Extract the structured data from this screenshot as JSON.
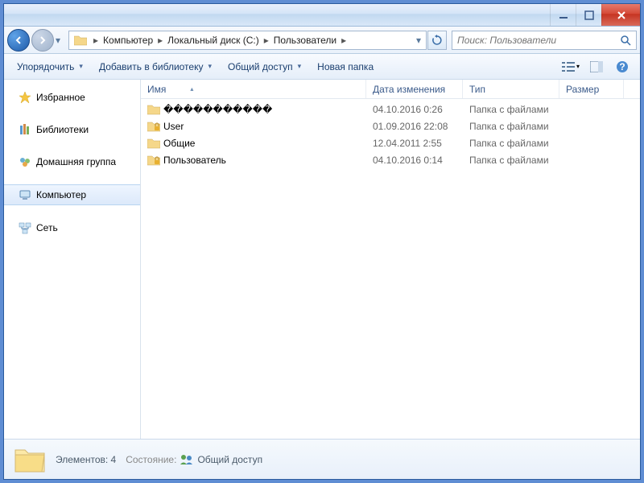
{
  "breadcrumb": [
    "Компьютер",
    "Локальный диск (C:)",
    "Пользователи"
  ],
  "search_placeholder": "Поиск: Пользователи",
  "toolbar": {
    "organize": "Упорядочить",
    "include": "Добавить в библиотеку",
    "share": "Общий доступ",
    "new_folder": "Новая папка"
  },
  "nav_pane": {
    "favorites": "Избранное",
    "libraries": "Библиотеки",
    "homegroup": "Домашняя группа",
    "computer": "Компьютер",
    "network": "Сеть"
  },
  "columns": {
    "name": "Имя",
    "date": "Дата изменения",
    "type": "Тип",
    "size": "Размер"
  },
  "files": [
    {
      "name": "�����������",
      "date": "04.10.2016 0:26",
      "type": "Папка с файлами",
      "lock": false
    },
    {
      "name": "User",
      "date": "01.09.2016 22:08",
      "type": "Папка с файлами",
      "lock": true
    },
    {
      "name": "Общие",
      "date": "12.04.2011 2:55",
      "type": "Папка с файлами",
      "lock": false
    },
    {
      "name": "Пользователь",
      "date": "04.10.2016 0:14",
      "type": "Папка с файлами",
      "lock": true
    }
  ],
  "status": {
    "count_label": "Элементов: 4",
    "state_label": "Состояние:",
    "state_value": "Общий доступ"
  }
}
